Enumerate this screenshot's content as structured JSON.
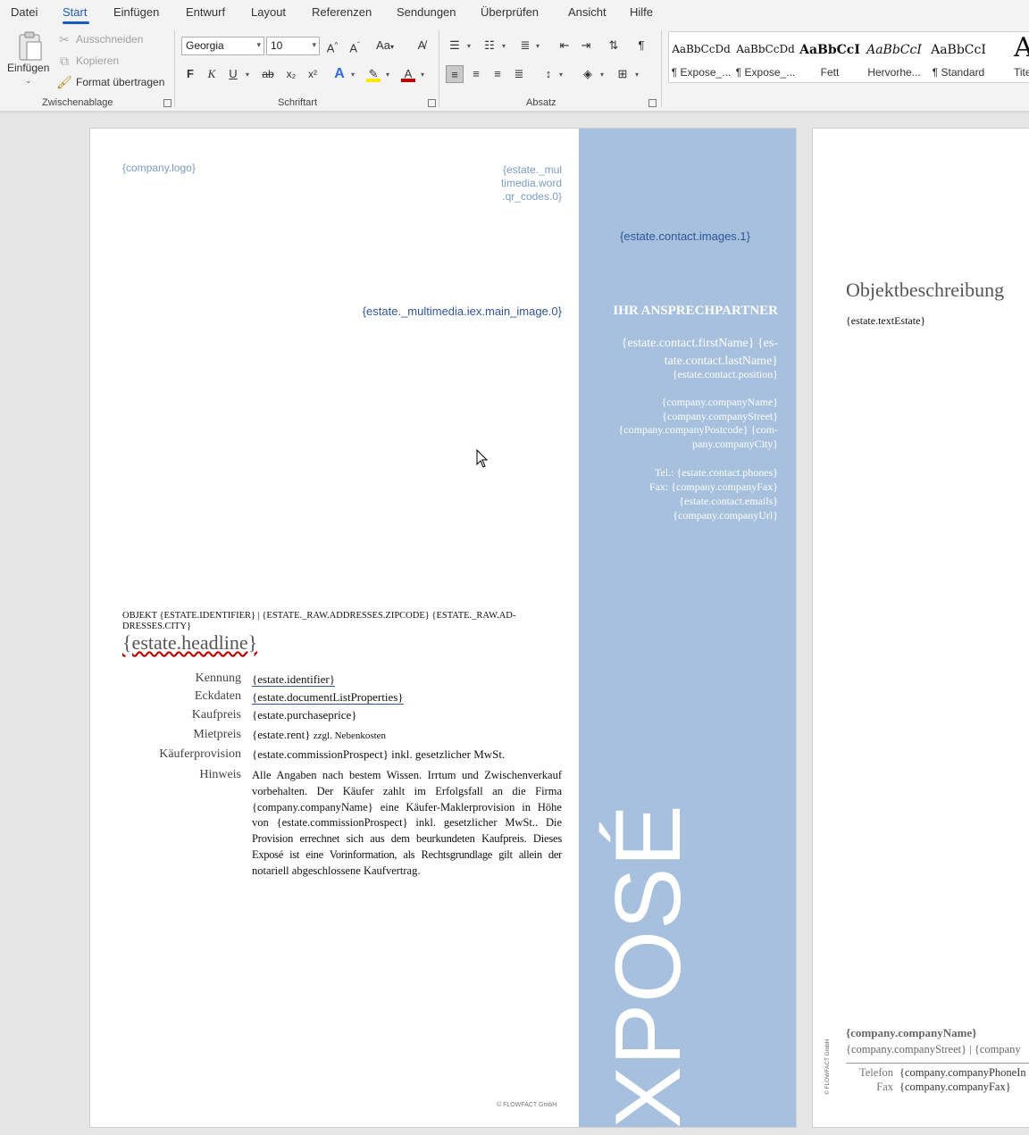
{
  "menu": {
    "items": [
      "Datei",
      "Start",
      "Einfügen",
      "Entwurf",
      "Layout",
      "Referenzen",
      "Sendungen",
      "Überprüfen",
      "Ansicht",
      "Hilfe"
    ]
  },
  "ribbon": {
    "clipboard": {
      "paste_label": "Einfügen",
      "cut_label": "Ausschneiden",
      "copy_label": "Kopieren",
      "format_painter_label": "Format übertragen",
      "group_label": "Zwischenablage"
    },
    "font": {
      "font_name": "Georgia",
      "font_size": "10",
      "bold": "F",
      "italic": "K",
      "underline": "U",
      "strikethrough": "ab",
      "subscript": "x₂",
      "superscript": "x²",
      "case": "Aa",
      "group_label": "Schriftart"
    },
    "paragraph": {
      "group_label": "Absatz"
    },
    "styles": {
      "items": [
        {
          "sample": "AaBbCcDd",
          "name": "¶ Expose_..."
        },
        {
          "sample": "AaBbCcDd",
          "name": "¶ Expose_..."
        },
        {
          "sample": "AaBbCcI",
          "name": "Fett"
        },
        {
          "sample": "AaBbCcI",
          "name": "Hervorhe..."
        },
        {
          "sample": "AaBbCcI",
          "name": "¶ Standard"
        },
        {
          "sample": "Aa",
          "name": "Tite"
        }
      ]
    }
  },
  "page1": {
    "company_logo": "{company.logo}",
    "qr_code_line1": "{estate._mul",
    "qr_code_line2": "timedia.word",
    "qr_code_line3": ".qr_codes.0}",
    "contact_image": "{estate.contact.images.1}",
    "main_image": "{estate._multimedia.iex.main_image.0}",
    "contact_heading": "IHR ANSPRECHPARTNER",
    "contact_name_line1": "{estate.contact.firstName} {es-",
    "contact_name_line2": "tate.contact.lastName}",
    "contact_position": "{estate.contact.position}",
    "company_name": "{company.companyName}",
    "company_street": "{company.companyStreet}",
    "company_postcode_line1": "{company.companyPostcode} {com-",
    "company_postcode_line2": "pany.companyCity}",
    "tel": "Tel.: {estate.contact.phones}",
    "fax": "Fax: {company.companyFax}",
    "email": "{estate.contact.emails}",
    "url": "{company.companyUrl}",
    "expose_text": "EXPOSÉ",
    "object_line1": "OBJEKT {ESTATE.IDENTIFIER} | {ESTATE._RAW.ADDRESSES.ZIPCODE} {ESTATE._RAW.AD-",
    "object_line2": "DRESSES.CITY}",
    "headline": "{estate.headline}",
    "details": [
      {
        "label": "Kennung",
        "value": "{estate.identifier}"
      },
      {
        "label": "Eckdaten",
        "value": "{estate.documentListProperties}"
      },
      {
        "label": "Kaufpreis",
        "value": "{estate.purchaseprice}"
      },
      {
        "label": "Mietpreis",
        "value": "{estate.rent}",
        "suffix": "zzgl. Nebenkosten"
      },
      {
        "label": "Käuferprovision",
        "value": "{estate.commissionProspect} inkl. gesetzlicher MwSt."
      },
      {
        "label": "Hinweis",
        "value": ""
      }
    ],
    "hinweis_lines": [
      "Alle Angaben nach bestem Wissen. Irrtum und Zwischenverkauf",
      "vorbehalten. Der Käufer zahlt im Erfolgsfall an die Firma",
      "{company.companyName} eine Käufer-Maklerprovision in Höhe",
      "von {estate.commissionProspect} inkl. gesetzlicher MwSt.. Die",
      "Provision errechnet sich aus dem beurkundeten Kaufpreis. Dieses",
      "Exposé ist eine Vorinformation, als Rechtsgrundlage gilt allein der",
      "notariell abgeschlossene Kaufvertrag."
    ],
    "copyright": "© FLOWFACT GmbH"
  },
  "page2": {
    "heading": "Objektbeschreibung",
    "text_estate": "{estate.textEstate}",
    "footer_company_name": "{company.companyName}",
    "footer_street": "{company.companyStreet} | {company",
    "footer_phone_label": "Telefon",
    "footer_phone_value": "{company.companyPhoneIn",
    "footer_fax_label": "Fax",
    "footer_fax_value": "{company.companyFax}",
    "vertical_copyright": "© FLOWFACT GmbH"
  }
}
